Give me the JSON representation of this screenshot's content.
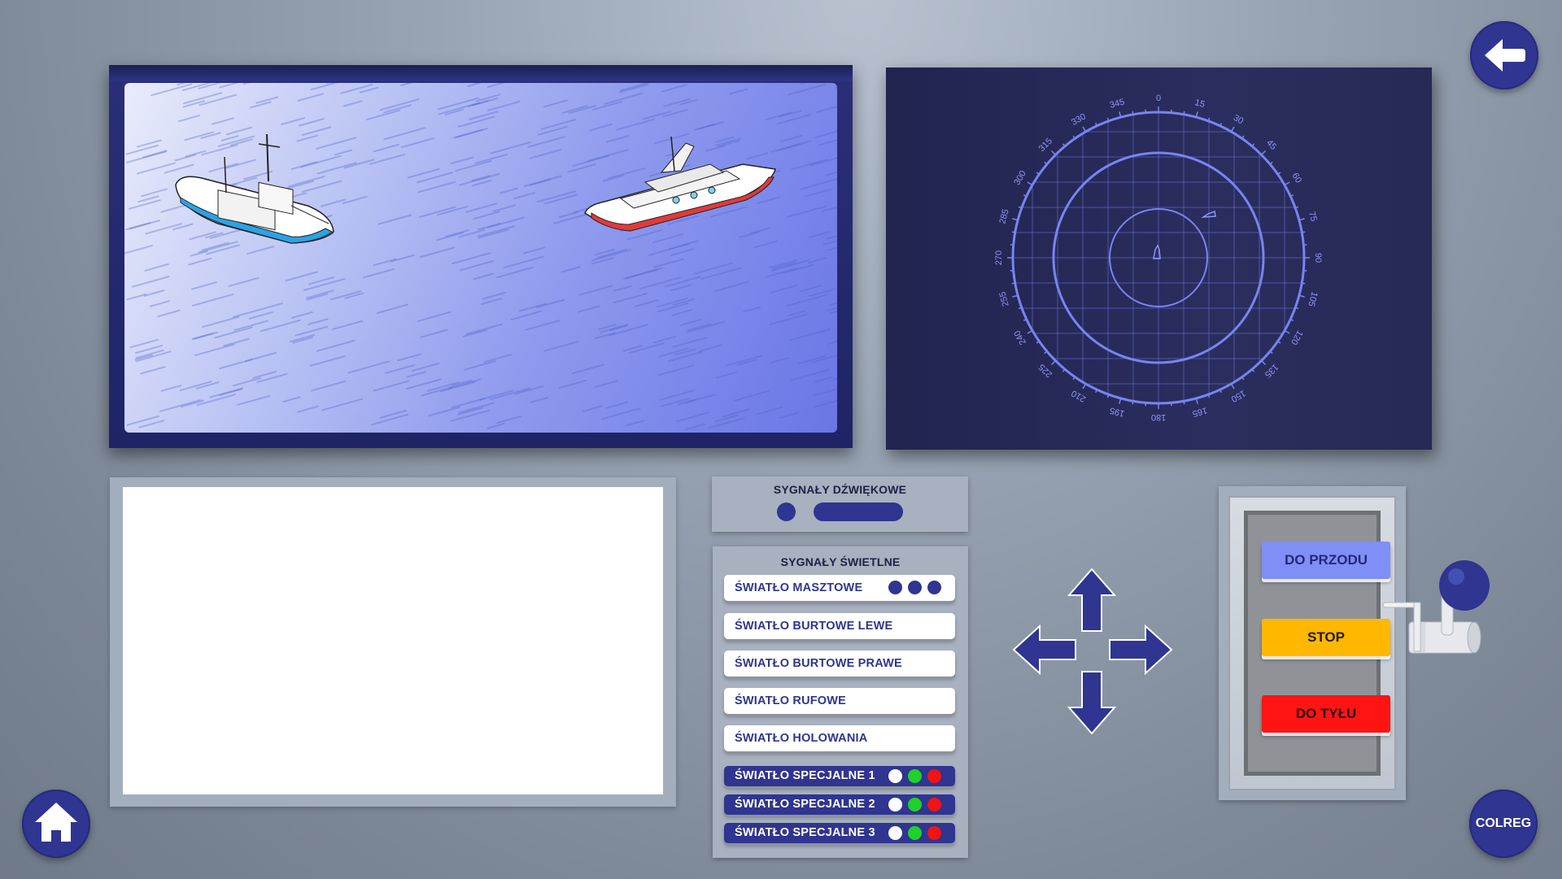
{
  "sound_signals": {
    "title": "SYGNAŁY DŹWIĘKOWE"
  },
  "light_signals": {
    "title": "SYGNAŁY ŚWIETLNE",
    "items": [
      {
        "label": "ŚWIATŁO MASZTOWE"
      },
      {
        "label": "ŚWIATŁO BURTOWE LEWE"
      },
      {
        "label": "ŚWIATŁO BURTOWE PRAWE"
      },
      {
        "label": "ŚWIATŁO RUFOWE"
      },
      {
        "label": "ŚWIATŁO HOLOWANIA"
      },
      {
        "label": "ŚWIATŁO SPECJALNE 1"
      },
      {
        "label": "ŚWIATŁO SPECJALNE 2"
      },
      {
        "label": "ŚWIATŁO SPECJALNE 3"
      }
    ],
    "special_light_colors": [
      "#ffffff",
      "#1fd12a",
      "#f01414"
    ],
    "mast_dot_color": "#2f3590"
  },
  "telegraph": {
    "forward_label": "DO PRZODU",
    "stop_label": "STOP",
    "reverse_label": "DO TYŁU",
    "forward_color": "#7f8ff5",
    "stop_color": "#ffb700",
    "reverse_color": "#ff1414"
  },
  "radar": {
    "bearings": [
      "0",
      "15",
      "30",
      "45",
      "60",
      "75",
      "90",
      "105",
      "120",
      "135",
      "150",
      "165",
      "180",
      "195",
      "210",
      "225",
      "240",
      "255",
      "270",
      "285",
      "300",
      "315",
      "330",
      "345"
    ]
  },
  "nav": {
    "colreg_label": "COLREG"
  },
  "colors": {
    "accent": "#2f3590",
    "radar_line": "#7b83f0"
  }
}
